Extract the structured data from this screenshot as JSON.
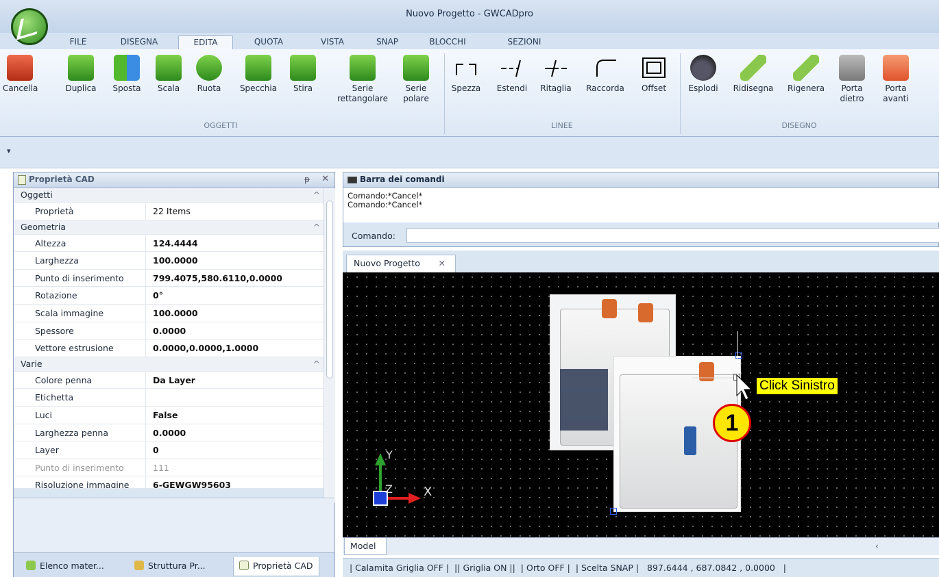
{
  "window": {
    "title": "Nuovo Progetto - GWCADpro"
  },
  "ribbon_tabs": [
    "FILE",
    "DISEGNA",
    "EDITA",
    "QUOTA",
    "VISTA",
    "SNAP",
    "BLOCCHI",
    "SEZIONI"
  ],
  "active_tab": "EDITA",
  "ribbon": {
    "oggetti": {
      "label": "OGGETTI",
      "buttons": [
        "Cancella",
        "Duplica",
        "Sposta",
        "Scala",
        "Ruota",
        "Specchia",
        "Stira",
        "Serie rettangolare",
        "Serie polare"
      ]
    },
    "linee": {
      "label": "LINEE",
      "buttons": [
        "Spezza",
        "Estendi",
        "Ritaglia",
        "Raccorda",
        "Offset"
      ]
    },
    "disegno": {
      "label": "DISEGNO",
      "buttons": [
        "Esplodi",
        "Ridisegna",
        "Rigenera",
        "Porta dietro",
        "Porta avanti"
      ]
    }
  },
  "qat_symbol": "▾",
  "properties": {
    "title": "Proprietà CAD",
    "pin": "ᵽ",
    "close": "✕",
    "sections": {
      "oggetti": {
        "name": "Oggetti",
        "rows": [
          {
            "k": "Proprietà",
            "v": "22 Items"
          }
        ]
      },
      "geometria": {
        "name": "Geometria",
        "rows": [
          {
            "k": "Altezza",
            "v": "124.4444"
          },
          {
            "k": "Larghezza",
            "v": "100.0000"
          },
          {
            "k": "Punto di inserimento",
            "v": "799.4075,580.6110,0.0000"
          },
          {
            "k": "Rotazione",
            "v": "0°"
          },
          {
            "k": "Scala immagine",
            "v": "100.0000"
          },
          {
            "k": "Spessore",
            "v": "0.0000"
          },
          {
            "k": "Vettore estrusione",
            "v": "0.0000,0.0000,1.0000"
          }
        ]
      },
      "varie": {
        "name": "Varie",
        "rows": [
          {
            "k": "Colore penna",
            "v": "Da Layer"
          },
          {
            "k": "Etichetta",
            "v": ""
          },
          {
            "k": "Luci",
            "v": "False"
          },
          {
            "k": "Larghezza penna",
            "v": "0.0000"
          },
          {
            "k": "Layer",
            "v": "0"
          },
          {
            "k": "Punto di inserimento",
            "v": "111"
          },
          {
            "k": "Risoluzione immagine",
            "v": "6-GEWGW95603"
          }
        ]
      }
    }
  },
  "bottom_tabs": [
    "Elenco mater...",
    "Struttura Pr...",
    "Proprietà CAD"
  ],
  "command_bar": {
    "title": "Barra dei comandi",
    "log": [
      "Comando:*Cancel*",
      "Comando:*Cancel*"
    ],
    "prompt_label": "Comando:",
    "input_value": ""
  },
  "document_tab": {
    "label": "Nuovo Progetto",
    "close": "✕"
  },
  "canvas": {
    "axis_y": "Y",
    "axis_x": "X",
    "axis_z": "Z",
    "callout_label": "Click Sinistro",
    "step_badge": "1"
  },
  "model_tab": "Model",
  "scroll_left": "‹",
  "status_bar": "| Calamita Griglia OFF |  || Griglia ON ||  | Orto OFF |  | Scelta SNAP |   897.6444 , 687.0842 , 0.0000   |"
}
